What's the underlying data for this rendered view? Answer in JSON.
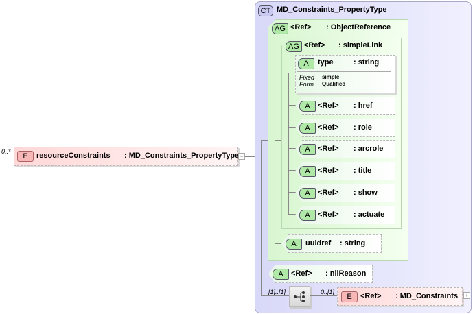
{
  "root_element": {
    "cardinality": "0..*",
    "badge": "E",
    "name": "resourceConstraints",
    "type": ": MD_Constraints_PropertyType",
    "toggle": "−"
  },
  "complex_type": {
    "badge": "CT",
    "name": "MD_Constraints_PropertyType"
  },
  "object_reference": {
    "badge": "AG",
    "name": "<Ref>",
    "type": ": ObjectReference"
  },
  "simple_link": {
    "badge": "AG",
    "name": "<Ref>",
    "type": ": simpleLink"
  },
  "type_attr": {
    "badge": "A",
    "name": "type",
    "type": ": string",
    "fixed_label": "Fixed",
    "fixed_value": "simple",
    "form_label": "Form",
    "form_value": "Qualified"
  },
  "attributes": [
    {
      "badge": "A",
      "name": "<Ref>",
      "type": ": href"
    },
    {
      "badge": "A",
      "name": "<Ref>",
      "type": ": role"
    },
    {
      "badge": "A",
      "name": "<Ref>",
      "type": ": arcrole"
    },
    {
      "badge": "A",
      "name": "<Ref>",
      "type": ": title"
    },
    {
      "badge": "A",
      "name": "<Ref>",
      "type": ": show"
    },
    {
      "badge": "A",
      "name": "<Ref>",
      "type": ": actuate"
    }
  ],
  "uuidref": {
    "badge": "A",
    "name": "uuidref",
    "type": ": string"
  },
  "nil_reason": {
    "badge": "A",
    "name": "<Ref>",
    "type": ": nilReason"
  },
  "sequence": {
    "cardinality": "[1]..[1]",
    "icon": "sequence-icon"
  },
  "md_constraints": {
    "cardinality": "0..[1]",
    "badge": "E",
    "name": "<Ref>",
    "type": ": MD_Constraints",
    "toggle": "+"
  }
}
